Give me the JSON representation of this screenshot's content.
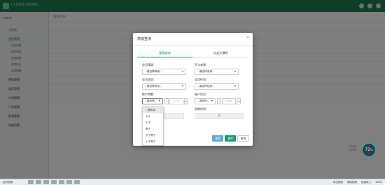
{
  "app": {
    "logo_text": "CLOUD·HERBS"
  },
  "sidebar": {
    "user": "admin",
    "items": [
      {
        "label": "工作台"
      },
      {
        "label": "会员管理"
      },
      {
        "label": "会员列表"
      },
      {
        "label": "会员等级"
      },
      {
        "label": "会员标签"
      },
      {
        "label": "会员积分"
      },
      {
        "label": "会员储值"
      },
      {
        "label": "营销管理"
      },
      {
        "label": "商品管理"
      },
      {
        "label": "订单管理"
      },
      {
        "label": "门店管理"
      },
      {
        "label": "报表管理"
      },
      {
        "label": "系统设置"
      }
    ]
  },
  "main": {
    "breadcrumb": "会员列表"
  },
  "float_widget": {
    "percent": "72",
    "up": "0.4K/s",
    "down": "0.5K/s"
  },
  "status_bar": {
    "left": "会员档案",
    "right": [
      "导出档案",
      "清除档案",
      "批量导入"
    ],
    "zoom": "100%"
  },
  "modal": {
    "title": "高级查询",
    "close": "×",
    "tabs": [
      {
        "label": "基础查询"
      },
      {
        "label": "自定义属性"
      }
    ],
    "fields": {
      "level_label": "会员等级：",
      "level_value": "--请选择等级--",
      "card_label": "开卡来源：",
      "card_value": "--请选择来源--",
      "status_label": "会员状态：",
      "status_value": "--请选择状态--",
      "gender_label": "会员性别：",
      "gender_value": "--请选择性别--",
      "balance_label": "账户余额：",
      "balance_op": "--请选择--",
      "balance_value": "0.00",
      "points_label": "账户积分：",
      "points_op": "--请选择--",
      "points_value": "0.00",
      "date_label": "到期时间：",
      "range_sep": "至",
      "minus": "-",
      "plus": "+"
    },
    "dropdown_options": [
      "--请选择--",
      "大于",
      "小于",
      "等于",
      "大于等于",
      "小于等于"
    ],
    "buttons": {
      "reset": "重置",
      "query": "查询",
      "cancel": "取消"
    }
  }
}
